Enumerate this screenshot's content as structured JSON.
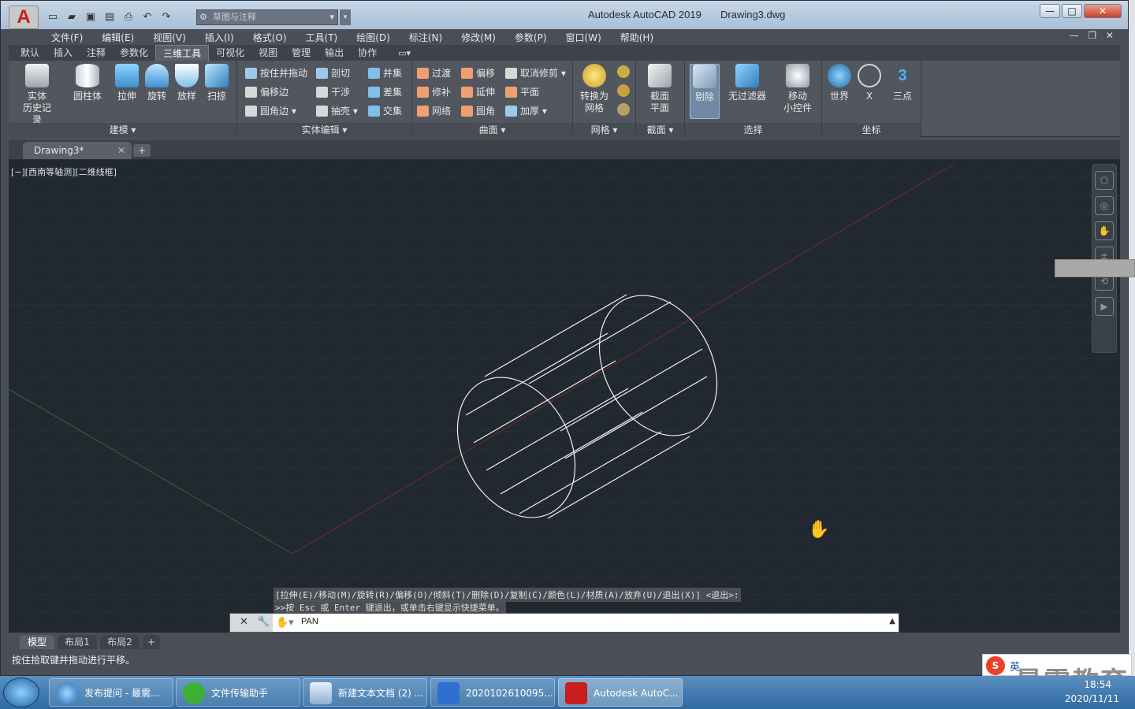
{
  "app": {
    "title": "Autodesk AutoCAD 2019",
    "file": "Drawing3.dwg",
    "logo": "A",
    "workspace": "草图与注释",
    "brand_color": "#c81e1e"
  },
  "window_controls": {
    "minimize": "—",
    "maximize": "□",
    "close": "✕"
  },
  "menu": [
    "文件(F)",
    "编辑(E)",
    "视图(V)",
    "插入(I)",
    "格式(O)",
    "工具(T)",
    "绘图(D)",
    "标注(N)",
    "修改(M)",
    "参数(P)",
    "窗口(W)",
    "帮助(H)"
  ],
  "ribbon_tabs": [
    "默认",
    "插入",
    "注释",
    "参数化",
    "三维工具",
    "可视化",
    "视图",
    "管理",
    "输出",
    "协作"
  ],
  "ribbon_active_tab": "三维工具",
  "ribbon": {
    "modeling": {
      "title": "建模 ▾",
      "buttons": [
        "实体\n历史记录",
        "圆柱体",
        "拉伸",
        "旋转",
        "放样",
        "扫掠"
      ]
    },
    "solid_edit": {
      "title": "实体编辑 ▾",
      "col1": [
        "按住并拖动",
        "偏移边",
        "圆角边 ▾"
      ],
      "col2": [
        "剖切",
        "干涉",
        "抽壳 ▾"
      ],
      "col3": [
        "并集",
        "差集",
        "交集"
      ]
    },
    "surface": {
      "title": "曲面 ▾",
      "col1": [
        "过渡",
        "修补",
        "网络"
      ],
      "col2": [
        "偏移",
        "延伸",
        "圆角"
      ],
      "col3": [
        "取消修剪 ▾",
        "平面",
        "加厚 ▾"
      ]
    },
    "mesh": {
      "title": "网格 ▾",
      "convert": "转换为\n网格"
    },
    "section": {
      "title": "截面 ▾",
      "plane": "截面\n平面"
    },
    "selection": {
      "title": "选择",
      "cull": "剔除",
      "filter": "无过滤器",
      "gizmo": "移动\n小控件"
    },
    "coordinates": {
      "title": "坐标",
      "world": "世界",
      "x": "X",
      "three_point": "三点"
    }
  },
  "doc_tab": {
    "name": "Drawing3*",
    "close": "✕",
    "add": "+"
  },
  "viewport": {
    "label": "[−][西南等轴测][二维线框]",
    "history_line1": "[拉伸(E)/移动(M)/旋转(R)/偏移(O)/倾斜(T)/删除(D)/复制(C)/颜色(L)/材质(A)/放弃(U)/退出(X)] <退出>:",
    "history_line2": ">>按 Esc 或 Enter 键退出，或单击右键显示快捷菜单。",
    "command_text": "PAN",
    "background": "#212830"
  },
  "layout_tabs": [
    "模型",
    "布局1",
    "布局2",
    "+"
  ],
  "status_text": "按住拾取键并拖动进行平移。",
  "taskbar": {
    "items": [
      "发布提问 - 最需...",
      "文件传输助手",
      "新建文本文档 (2) ...",
      "2020102610095...",
      "Autodesk AutoC..."
    ],
    "time": "18:54",
    "date": "2020/11/11"
  },
  "ime": {
    "lang": "英"
  },
  "watermark": "最需教育"
}
